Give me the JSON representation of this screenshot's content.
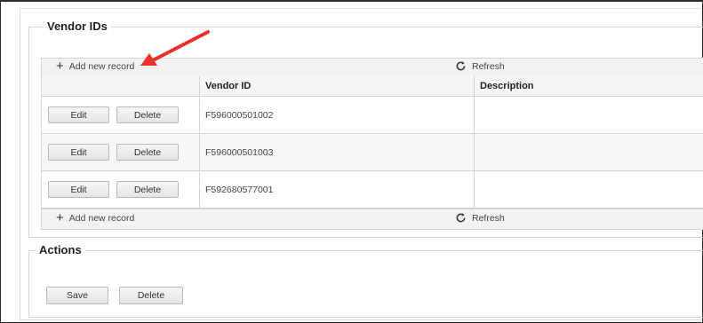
{
  "sections": {
    "vendor_ids_title": "Vendor IDs",
    "actions_title": "Actions"
  },
  "grid": {
    "add_new_record": "Add new record",
    "refresh": "Refresh",
    "columns": [
      "Vendor ID",
      "Description"
    ],
    "rows": [
      {
        "vendor_id": "F596000501002",
        "description": "",
        "edit": "Edit",
        "delete": "Delete"
      },
      {
        "vendor_id": "F596000501003",
        "description": "",
        "edit": "Edit",
        "delete": "Delete"
      },
      {
        "vendor_id": "F592680577001",
        "description": "",
        "edit": "Edit",
        "delete": "Delete"
      }
    ]
  },
  "actions": {
    "save": "Save",
    "delete": "Delete"
  },
  "icons": {
    "add": "plus-icon",
    "refresh": "refresh-icon",
    "annotation": "red-arrow"
  },
  "colors": {
    "annotation_arrow": "#e8322b"
  }
}
